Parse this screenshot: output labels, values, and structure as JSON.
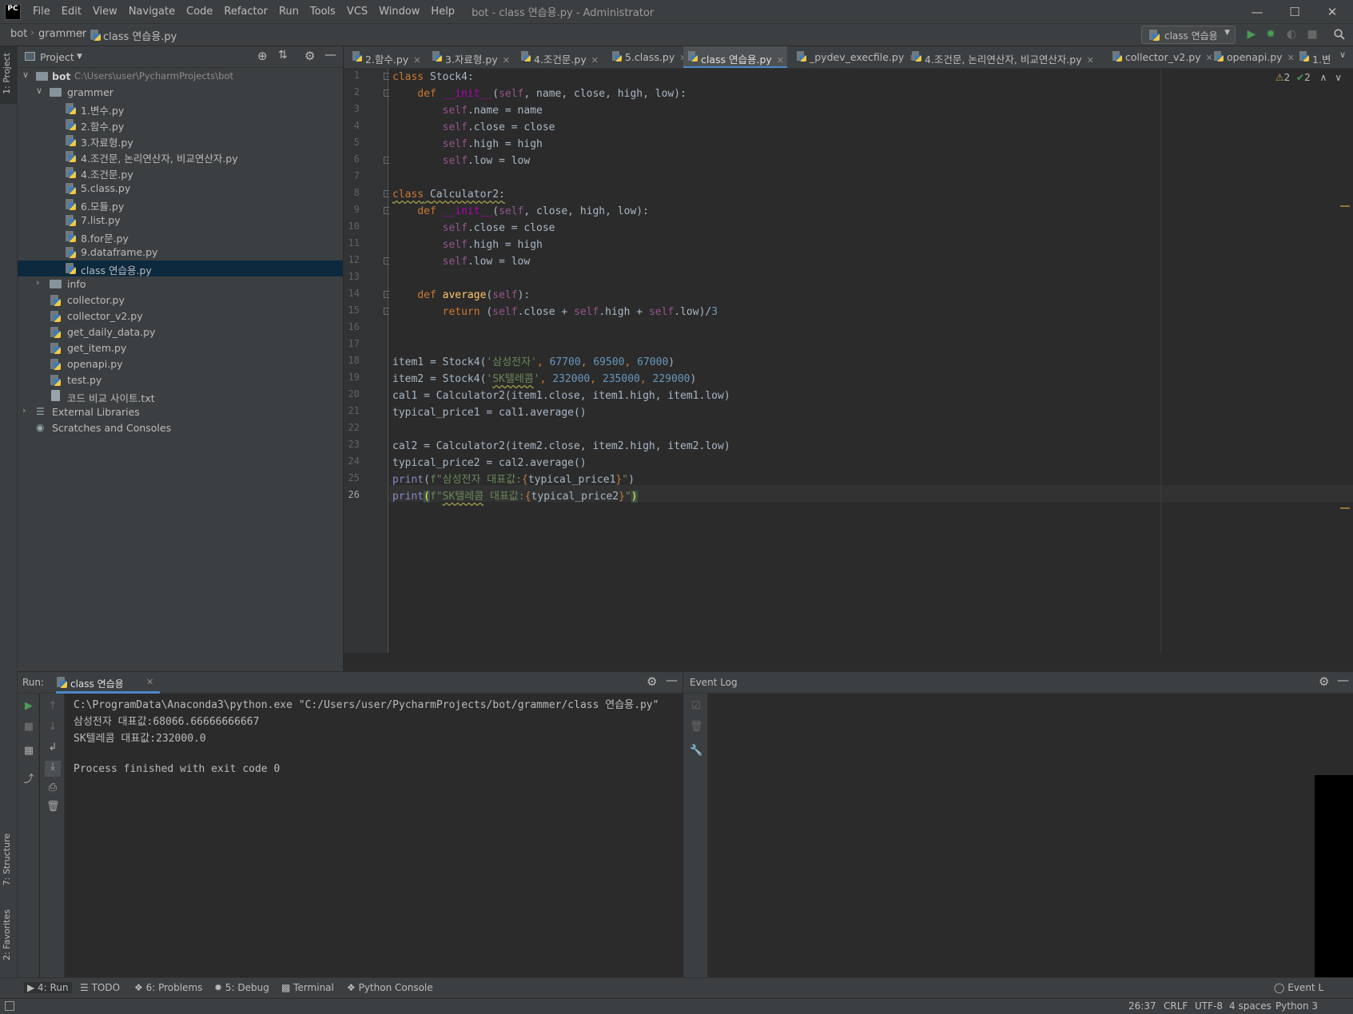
{
  "app": {
    "logo_text": "PC",
    "window_title": "bot - class 연습용.py - Administrator",
    "menu": [
      "File",
      "Edit",
      "View",
      "Navigate",
      "Code",
      "Refactor",
      "Run",
      "Tools",
      "VCS",
      "Window",
      "Help"
    ]
  },
  "breadcrumb": [
    "bot",
    "grammer",
    "class 연습용.py"
  ],
  "run_config": "class 연습용",
  "project": {
    "title": "Project",
    "root_name": "bot",
    "root_path": "C:\\Users\\user\\PycharmProjects\\bot",
    "folder_grammer": "grammer",
    "grammer_files": [
      "1.변수.py",
      "2.함수.py",
      "3.자료형.py",
      "4.조건문, 논리연산자, 비교연산자.py",
      "4.조건문.py",
      "5.class.py",
      "6.모듈.py",
      "7.list.py",
      "8.for문.py",
      "9.dataframe.py",
      "class 연습용.py"
    ],
    "folder_info": "info",
    "root_files": [
      "collector.py",
      "collector_v2.py",
      "get_daily_data.py",
      "get_item.py",
      "openapi.py",
      "test.py",
      "코드 비교 사이트.txt"
    ],
    "external_libraries": "External Libraries",
    "scratches": "Scratches and Consoles"
  },
  "left_stripe": {
    "project_tab": "1: Project",
    "structure_tab": "7: Structure",
    "favorites_tab": "2: Favorites"
  },
  "editor_tabs": [
    "2.함수.py",
    "3.자료형.py",
    "4.조건문.py",
    "5.class.py",
    "class 연습용.py",
    "_pydev_execfile.py",
    "4.조건문, 논리연산자, 비교연산자.py",
    "collector_v2.py",
    "openapi.py",
    "1.변"
  ],
  "inspection": {
    "warnings": "2",
    "weak_warnings": "2"
  },
  "line_numbers": [
    "1",
    "2",
    "3",
    "4",
    "5",
    "6",
    "7",
    "8",
    "9",
    "10",
    "11",
    "12",
    "13",
    "14",
    "15",
    "16",
    "17",
    "18",
    "19",
    "20",
    "21",
    "22",
    "23",
    "24",
    "25",
    "26"
  ],
  "code": {
    "l1_kw": "class",
    "l1_rest": " Stock4:",
    "l2_kw": "def",
    "l2_fn": "__init__",
    "l2_self": "self",
    "l2_rest": ", name, close, high, low):",
    "l3_self": "self",
    "l3_rest": ".name = name",
    "l4_self": "self",
    "l4_rest": ".close = close",
    "l5_self": "self",
    "l5_rest": ".high = high",
    "l6_self": "self",
    "l6_rest": ".low = low",
    "l8_kw": "class",
    "l8_name": "Calculator2:",
    "l9_kw": "def",
    "l9_fn": "__init__",
    "l9_self": "self",
    "l9_rest": ", close, high, low):",
    "l10_self": "self",
    "l10_rest": ".close = close",
    "l11_self": "self",
    "l11_rest": ".high = high",
    "l12_self": "self",
    "l12_rest": ".low = low",
    "l14_kw": "def",
    "l14_fn": "average",
    "l14_self": "self",
    "l14_rest": "):",
    "l15_kw": "return",
    "l15_self1": "self",
    "l15_mid1": ".close + ",
    "l15_self2": "self",
    "l15_mid2": ".high + ",
    "l15_self3": "self",
    "l15_mid3": ".low)/",
    "l15_num": "3",
    "l18_pre": "item1 = Stock4(",
    "l18_str": "'삼성전자'",
    "l18_n1": "67700",
    "l18_n2": "69500",
    "l18_n3": "67000",
    "l19_pre": "item2 = Stock4(",
    "l19_str_a": "'",
    "l19_str_b": "SK텔레콤",
    "l19_str_c": "'",
    "l19_n1": "232000",
    "l19_n2": "235000",
    "l19_n3": "229000",
    "l20": "cal1 = Calculator2(item1.close, item1.high, item1.low)",
    "l21": "typical_price1 = cal1.average()",
    "l23": "cal2 = Calculator2(item2.close, item2.high, item2.low)",
    "l24": "typical_price2 = cal2.average()",
    "l25_print": "print",
    "l25_str": "f\"삼성전자 대표값:",
    "l25_var": "typical_price1",
    "l25_end": "\"",
    "l26_print": "print",
    "l26_str_a": "f\"",
    "l26_str_b": "SK텔레콤",
    "l26_str_c": " 대표값:",
    "l26_var": "typical_price2",
    "l26_end": "\""
  },
  "run_panel": {
    "label": "Run:",
    "tab": "class 연습용",
    "output": [
      "C:\\ProgramData\\Anaconda3\\python.exe \"C:/Users/user/PycharmProjects/bot/grammer/class 연습용.py\"",
      "삼성전자 대표값:68066.66666666667",
      "SK텔레콤 대표값:232000.0",
      "",
      "Process finished with exit code 0"
    ]
  },
  "event_log": {
    "title": "Event Log"
  },
  "tool_windows": [
    "4: Run",
    "TODO",
    "6: Problems",
    "5: Debug",
    "Terminal",
    "Python Console",
    "Event L"
  ],
  "status": {
    "position": "26:37",
    "line_sep": "CRLF",
    "encoding": "UTF-8",
    "indent": "4 spaces",
    "interpreter": "Python 3"
  },
  "colors": {
    "accent": "#4a88c7",
    "selection": "#0d293e",
    "run_green": "#499c54"
  }
}
